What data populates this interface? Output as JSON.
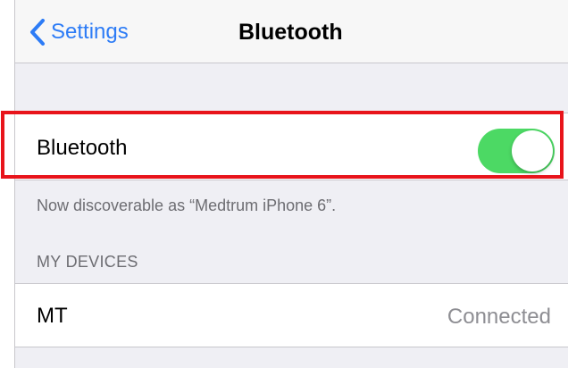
{
  "navbar": {
    "back_label": "Settings",
    "title": "Bluetooth"
  },
  "bluetooth_cell": {
    "label": "Bluetooth",
    "toggle_on": true,
    "toggle_color": "#4cd964"
  },
  "discoverable_text": "Now discoverable as “Medtrum iPhone 6”.",
  "my_devices": {
    "header": "MY DEVICES",
    "devices": [
      {
        "name": "MT",
        "status": "Connected"
      }
    ]
  },
  "colors": {
    "accent": "#2d7cf6",
    "highlight_border": "#e8141b",
    "background": "#efeff4"
  },
  "icons": {
    "back": "chevron-left-icon"
  }
}
